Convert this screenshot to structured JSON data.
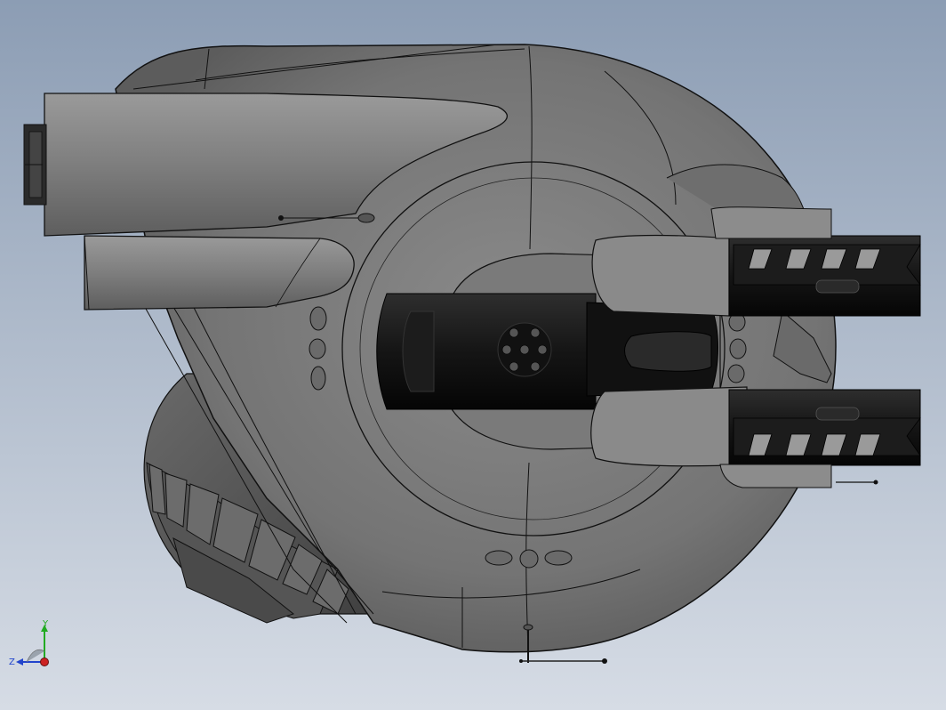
{
  "viewport": {
    "background_top": "#8c9db4",
    "background_bottom": "#d2d9e2"
  },
  "model": {
    "name": "turret-cad-model",
    "body_color": "#7d7d7d",
    "body_shade": "#5a5a5a",
    "edge_color": "#111111",
    "barrel_color": "#1a1a1a"
  },
  "triad": {
    "x_color": "#cc2222",
    "y_color": "#22aa22",
    "z_color": "#2244cc",
    "label_y": "Y",
    "label_z": "Z"
  }
}
